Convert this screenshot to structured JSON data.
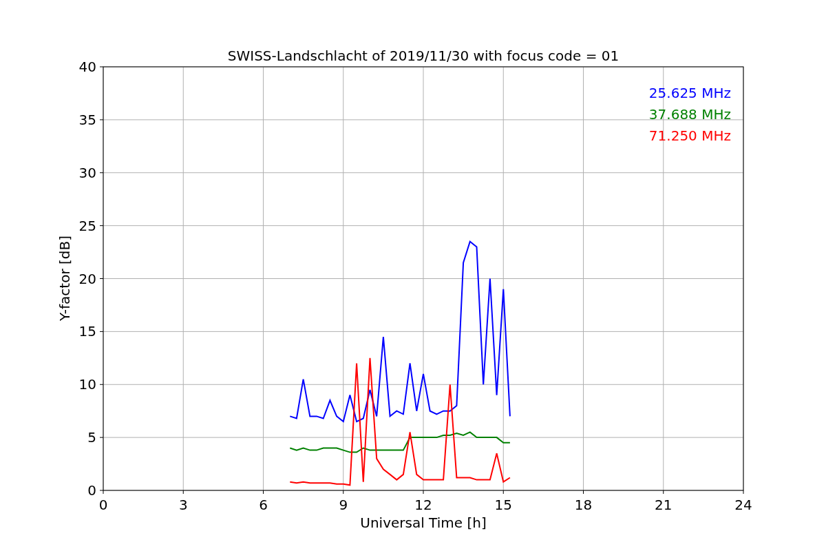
{
  "chart_data": {
    "type": "line",
    "title": "SWISS-Landschlacht of 2019/11/30 with focus code = 01",
    "xlabel": "Universal Time [h]",
    "ylabel": "Y-factor [dB]",
    "x": [
      7,
      7.25,
      7.5,
      7.75,
      8,
      8.25,
      8.5,
      8.75,
      9,
      9.25,
      9.5,
      9.75,
      10,
      10.25,
      10.5,
      10.75,
      11,
      11.25,
      11.5,
      11.75,
      12,
      12.25,
      12.5,
      12.75,
      13,
      13.25,
      13.5,
      13.75,
      14,
      14.25,
      14.5,
      14.75,
      15,
      15.25
    ],
    "series": [
      {
        "name": "25.625 MHz",
        "color": "#0000ff",
        "values": [
          7.0,
          6.8,
          10.5,
          7.0,
          7.0,
          6.8,
          8.5,
          7.0,
          6.5,
          9.0,
          6.5,
          6.8,
          9.5,
          7.0,
          14.5,
          7.0,
          7.5,
          7.2,
          12.0,
          7.5,
          11.0,
          7.5,
          7.2,
          7.5,
          7.5,
          8.0,
          21.5,
          23.5,
          23.0,
          10.0,
          20.0,
          9.0,
          19.0,
          7.0
        ]
      },
      {
        "name": "37.688 MHz",
        "color": "#008000",
        "values": [
          4.0,
          3.8,
          4.0,
          3.8,
          3.8,
          4.0,
          4.0,
          4.0,
          3.8,
          3.6,
          3.6,
          4.0,
          3.8,
          3.8,
          3.8,
          3.8,
          3.8,
          3.8,
          5.0,
          5.0,
          5.0,
          5.0,
          5.0,
          5.2,
          5.2,
          5.4,
          5.2,
          5.5,
          5.0,
          5.0,
          5.0,
          5.0,
          4.5,
          4.5
        ]
      },
      {
        "name": "71.250 MHz",
        "color": "#ff0000",
        "values": [
          0.8,
          0.7,
          0.8,
          0.7,
          0.7,
          0.7,
          0.7,
          0.6,
          0.6,
          0.5,
          12.0,
          0.8,
          12.5,
          3.0,
          2.0,
          1.5,
          1.0,
          1.5,
          5.5,
          1.5,
          1.0,
          1.0,
          1.0,
          1.0,
          10.0,
          1.2,
          1.2,
          1.2,
          1.0,
          1.0,
          1.0,
          3.5,
          0.8,
          1.2
        ]
      }
    ],
    "xlim": [
      0,
      24
    ],
    "ylim": [
      0,
      40
    ],
    "xticks": [
      0,
      3,
      6,
      9,
      12,
      15,
      18,
      21,
      24
    ],
    "yticks": [
      0,
      5,
      10,
      15,
      20,
      25,
      30,
      35,
      40
    ],
    "grid": true
  }
}
